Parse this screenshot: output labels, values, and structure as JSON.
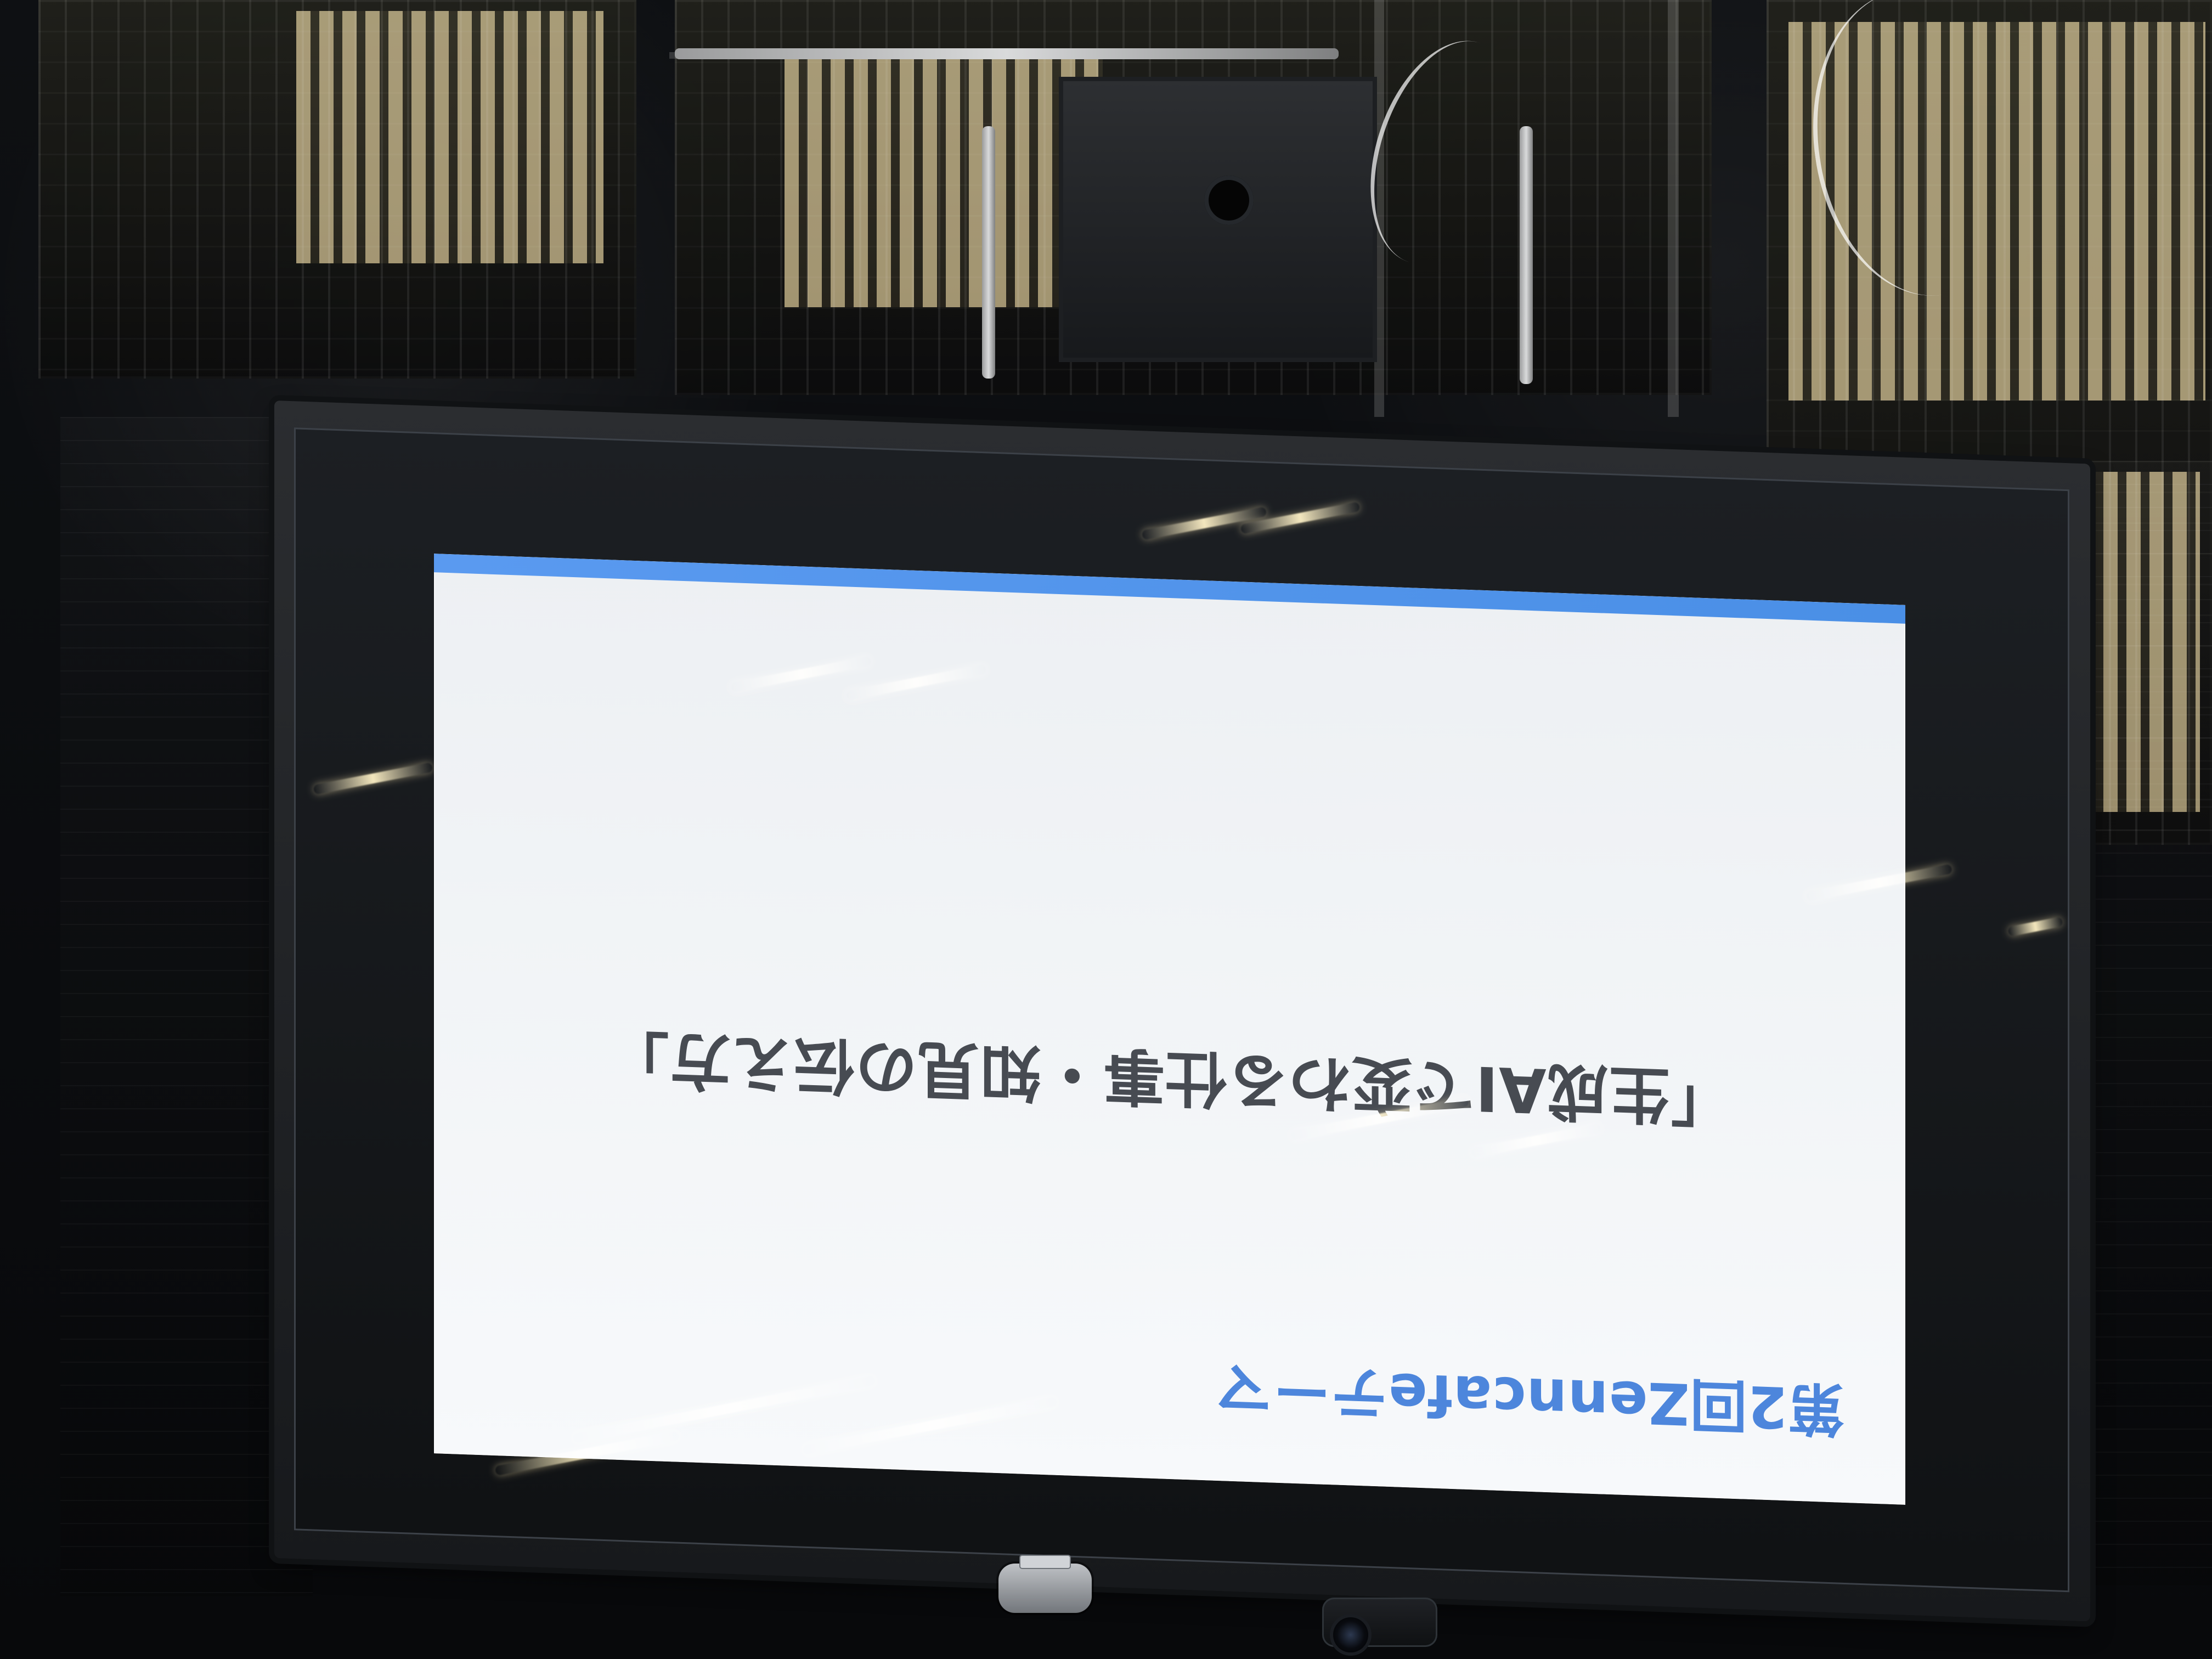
{
  "slide": {
    "heading": "第2回Zenncafeテーマ",
    "main_title": "「生成AIで変わる仕事・知見の伝え方」"
  }
}
